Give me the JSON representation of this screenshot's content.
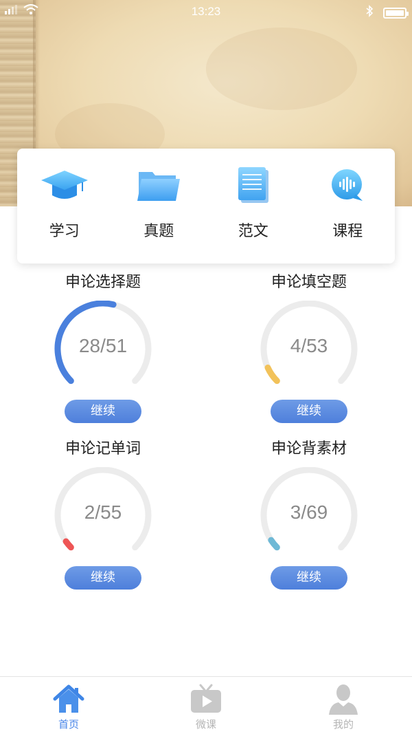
{
  "status_bar": {
    "time": "13:23",
    "signal_icon": "signal-icon",
    "wifi_icon": "wifi-icon",
    "bluetooth_icon": "bluetooth-icon",
    "battery_icon": "battery-icon"
  },
  "menu": {
    "items": [
      {
        "label": "学习",
        "icon": "graduation-cap-icon"
      },
      {
        "label": "真题",
        "icon": "folder-icon"
      },
      {
        "label": "范文",
        "icon": "document-icon"
      },
      {
        "label": "课程",
        "icon": "audio-bubble-icon"
      }
    ]
  },
  "progress": [
    {
      "title": "申论选择题",
      "done": 28,
      "total": 51,
      "value_text": "28/51",
      "color": "#4a80dd",
      "button": "继续"
    },
    {
      "title": "申论填空题",
      "done": 4,
      "total": 53,
      "value_text": "4/53",
      "color": "#f2c25a",
      "button": "继续"
    },
    {
      "title": "申论记单词",
      "done": 2,
      "total": 55,
      "value_text": "2/55",
      "color": "#ee5555",
      "button": "继续"
    },
    {
      "title": "申论背素材",
      "done": 3,
      "total": 69,
      "value_text": "3/69",
      "color": "#6fb9d6",
      "button": "继续"
    }
  ],
  "tab_bar": {
    "tabs": [
      {
        "label": "首页",
        "icon": "home-icon",
        "active": true
      },
      {
        "label": "微课",
        "icon": "tv-play-icon",
        "active": false
      },
      {
        "label": "我的",
        "icon": "user-icon",
        "active": false
      }
    ]
  },
  "colors": {
    "accent": "#4a86e8",
    "track": "#ececec"
  }
}
